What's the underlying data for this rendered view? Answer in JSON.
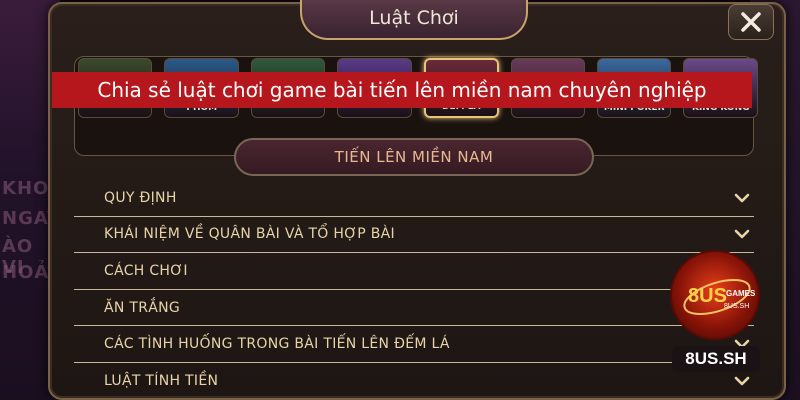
{
  "dialog": {
    "title": "Luật Chơi",
    "close_icon": "close-icon"
  },
  "games": {
    "items": [
      {
        "label": "",
        "color": "#3a4a2a"
      },
      {
        "label": "PHỎM",
        "color": "#2a5a8a"
      },
      {
        "label": "",
        "color": "#2e5a3a"
      },
      {
        "label": "",
        "color": "#5a3a8a"
      },
      {
        "label": "ĐẾM LÁ",
        "color": "#6a2a3a",
        "active": true
      },
      {
        "label": "",
        "color": "#6a3a5a"
      },
      {
        "label": "MINI POKER",
        "color": "#3a6aa0"
      },
      {
        "label": "KING KONG",
        "color": "#6a4a8a"
      }
    ]
  },
  "headline": "Chia sẻ luật chơi game bài tiến lên miền nam chuyên nghiệp",
  "section": "TIẾN LÊN MIỀN NAM",
  "rules": [
    "QUY ĐỊNH",
    "KHÁI NIỆM VỀ QUÂN BÀI VÀ TỔ HỢP BÀI",
    "CÁCH CHƠI",
    "ĂN TRẮNG",
    "CÁC TÌNH HUỐNG TRONG BÀI TIẾN LÊN ĐẾM LÁ",
    "LUẬT TÍNH TIỀN"
  ],
  "watermark": {
    "logo_top": "8US",
    "logo_right": "GAMES",
    "logo_bottom": "8US.SH",
    "site": "8US.SH"
  },
  "background": {
    "left_ghost": [
      "KHOẢ",
      "NGAY",
      "ÀO VI",
      "HOẢ"
    ]
  },
  "colors": {
    "accent_red": "#b5171d",
    "gold_text": "#e8d4a8",
    "pill_text": "#e8b890"
  }
}
